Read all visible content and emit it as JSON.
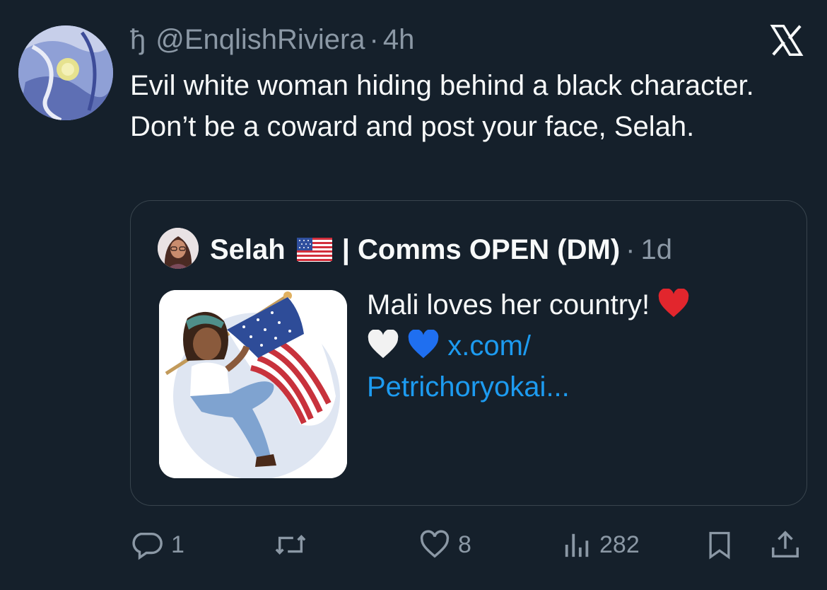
{
  "tweet": {
    "author_glyph": "ђ",
    "handle": "@EnqlishRiviera",
    "separator": "·",
    "time": "4h",
    "text": "Evil white woman hiding behind a black character. Don’t be a coward and post your face, Selah."
  },
  "quote": {
    "name": "Selah",
    "name_suffix": "| Comms OPEN (DM)",
    "separator": "·",
    "time": "1d",
    "text_main": "Mali loves her country!",
    "link_line1": "x.com/",
    "link_line2": "Petrichoryokai..."
  },
  "actions": {
    "reply_count": "1",
    "like_count": "8",
    "views_count": "282"
  },
  "icons": {
    "logo": "x-logo-icon",
    "reply": "reply-icon",
    "retweet": "retweet-icon",
    "like": "heart-icon",
    "views": "views-icon",
    "bookmark": "bookmark-icon",
    "share": "share-icon"
  },
  "colors": {
    "background": "#15202b",
    "text": "#f7f9f9",
    "muted": "#8b98a5",
    "link": "#1d9bf0",
    "border": "#38444d"
  }
}
